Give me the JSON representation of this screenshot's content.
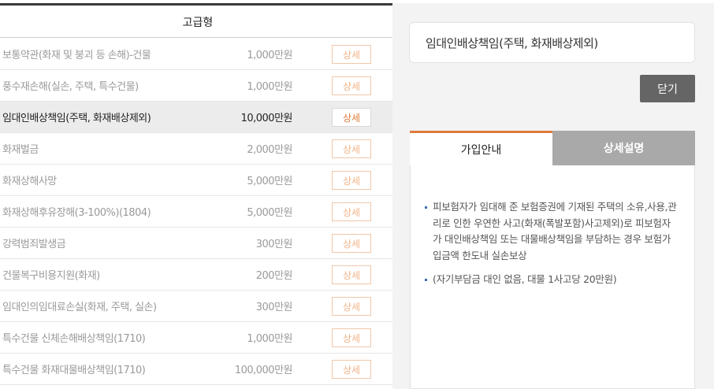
{
  "plan": {
    "header": "고급형"
  },
  "coverages": [
    {
      "name": "보통약관(화재 및 붕괴 등 손해)-건물",
      "amount": "1,000만원",
      "detail_label": "상세"
    },
    {
      "name": "풍수재손해(실손, 주택, 특수건물)",
      "amount": "1,000만원",
      "detail_label": "상세"
    },
    {
      "name": "임대인배상책임(주택, 화재배상제외)",
      "amount": "10,000만원",
      "detail_label": "상세",
      "active": true
    },
    {
      "name": "화재벌금",
      "amount": "2,000만원",
      "detail_label": "상세"
    },
    {
      "name": "화재상해사망",
      "amount": "5,000만원",
      "detail_label": "상세"
    },
    {
      "name": "화재상해후유장해(3-100%)(1804)",
      "amount": "5,000만원",
      "detail_label": "상세"
    },
    {
      "name": "강력범죄발생금",
      "amount": "300만원",
      "detail_label": "상세"
    },
    {
      "name": "건물복구비용지원(화재)",
      "amount": "200만원",
      "detail_label": "상세"
    },
    {
      "name": "임대인의임대료손실(화재, 주택, 실손)",
      "amount": "300만원",
      "detail_label": "상세"
    },
    {
      "name": "특수건물 신체손해배상책임(1710)",
      "amount": "1,000만원",
      "detail_label": "상세"
    },
    {
      "name": "특수건물 화재대물배상책임(1710)",
      "amount": "100,000만원",
      "detail_label": "상세"
    }
  ],
  "detail_panel": {
    "title": "임대인배상책임(주택, 화재배상제외)",
    "close_label": "닫기",
    "tabs": [
      {
        "label": "가입안내",
        "active": true
      },
      {
        "label": "상세설명",
        "active": false
      }
    ],
    "bullets": [
      "피보험자가 임대해 준 보험증권에 기재된 주택의 소유,사용,관리로 인한 우연한 사고(화재(폭발포함)사고제외)로 피보험자가 대인배상책임 또는 대물배상책임을 부담하는 경우 보험가입금액 한도내 실손보상",
      "(자기부담금 대인 없음, 대물 1사고당 20만원)"
    ]
  },
  "colors": {
    "accent": "#e07b3b",
    "close_button": "#656565",
    "inactive_tab": "#a9a9a9"
  }
}
